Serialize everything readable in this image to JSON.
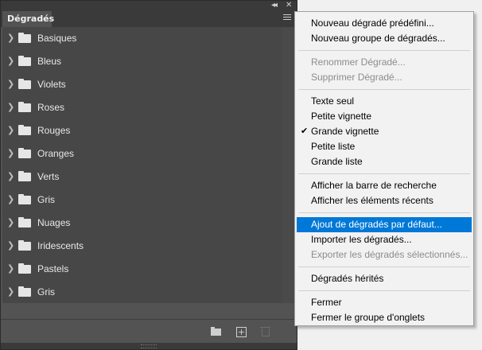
{
  "panel": {
    "tab_title": "Dégradés",
    "folders": [
      {
        "label": "Basiques"
      },
      {
        "label": "Bleus"
      },
      {
        "label": "Violets"
      },
      {
        "label": "Roses"
      },
      {
        "label": "Rouges"
      },
      {
        "label": "Oranges"
      },
      {
        "label": "Verts"
      },
      {
        "label": "Gris"
      },
      {
        "label": "Nuages"
      },
      {
        "label": "Iridescents"
      },
      {
        "label": "Pastels"
      },
      {
        "label": "Gris"
      }
    ],
    "icons": {
      "collapse": "double-chevron-icon",
      "close": "close-icon",
      "menu": "hamburger-menu-icon",
      "new_folder": "folder-icon",
      "new_gradient": "plus-square-icon",
      "delete": "trash-icon"
    }
  },
  "menu": {
    "items": [
      {
        "label": "Nouveau dégradé prédéfini...",
        "enabled": true
      },
      {
        "label": "Nouveau groupe de dégradés...",
        "enabled": true
      },
      {
        "label": "Renommer Dégradé...",
        "enabled": false
      },
      {
        "label": "Supprimer Dégradé...",
        "enabled": false
      },
      {
        "label": "Texte seul",
        "enabled": true
      },
      {
        "label": "Petite vignette",
        "enabled": true
      },
      {
        "label": "Grande vignette",
        "enabled": true,
        "checked": true
      },
      {
        "label": "Petite liste",
        "enabled": true
      },
      {
        "label": "Grande liste",
        "enabled": true
      },
      {
        "label": "Afficher la barre de recherche",
        "enabled": true
      },
      {
        "label": "Afficher les éléments récents",
        "enabled": true
      },
      {
        "label": "Ajout de dégradés par défaut...",
        "enabled": true,
        "highlighted": true
      },
      {
        "label": "Importer les dégradés...",
        "enabled": true
      },
      {
        "label": "Exporter les dégradés sélectionnés...",
        "enabled": false
      },
      {
        "label": "Dégradés hérités",
        "enabled": true
      },
      {
        "label": "Fermer",
        "enabled": true
      },
      {
        "label": "Fermer le groupe d'onglets",
        "enabled": true
      }
    ],
    "check_glyph": "✔",
    "highlight_color": "#0078d7"
  }
}
